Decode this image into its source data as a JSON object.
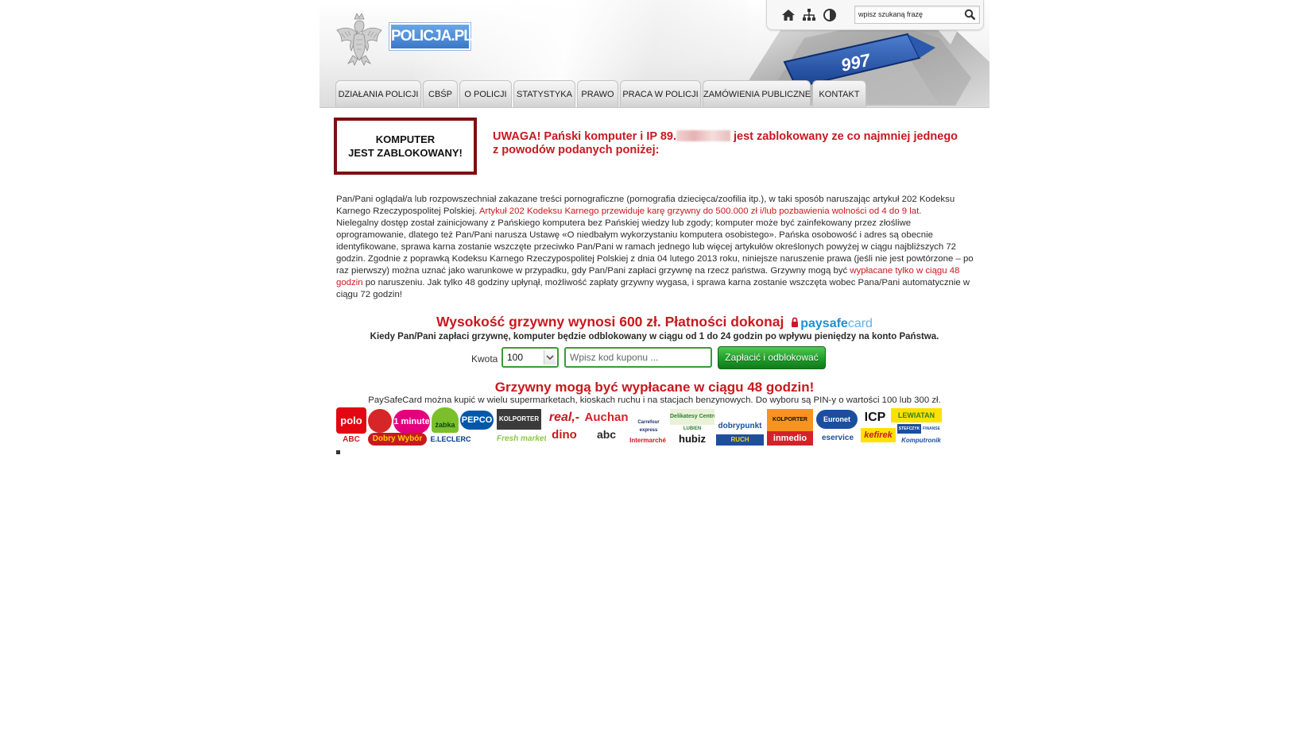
{
  "header": {
    "logo_text": "POLICJA.PL",
    "badge_number": "997",
    "search_placeholder": "wpisz szukaną frazę",
    "icons": [
      "home-icon",
      "sitemap-icon",
      "contrast-icon",
      "search-icon"
    ]
  },
  "nav": {
    "items": [
      {
        "label": "DZIAŁANIA POLICJI"
      },
      {
        "label": "CBŚP"
      },
      {
        "label": "O POLICJI"
      },
      {
        "label": "STATYSTYKA"
      },
      {
        "label": "PRAWO"
      },
      {
        "label": "PRACA W POLICJI"
      },
      {
        "label": "ZAMÓWIENIA PUBLICZNE"
      },
      {
        "label": "KONTAKT"
      }
    ]
  },
  "alert": {
    "box_line1": "KOMPUTER",
    "box_line2": "JEST ZABLOKOWANY!",
    "warning_part1": "UWAGA! Pański komputer i IP 89.",
    "warning_part2": " jest zablokowany ze co najmniej jednego",
    "warning_line2": "z powodów podanych poniżej:"
  },
  "body": {
    "p1_text": "Pan/Pani oglądał/a lub rozpowszechniał zakazane treści pornograficzne (pornografia dziecięca/zoofilia itp.), w taki sposób naruszając artykuł 202 Kodeksu Karnego Rzeczypospolitej Polskiej. ",
    "p1_red": "Artykuł 202 Kodeksu Karnego przewiduje karę grzywny do 500.000 zł i/lub pozbawienia wolności od 4 do 9 lat",
    "p1_end": ".",
    "p2_text": "Nielegalny dostęp został zainicjowany z Pańskiego komputera bez Pańskiej wiedzy lub zgody; komputer może być zainfekowany przez złośliwe oprogramowanie, dlatego też Pan/Pani narusza Ustawę «O niedbałym wykorzystaniu komputera osobistego». Pańska osobowość i adres są obecnie identyfikowane, sprawa karna zostanie wszczęte przeciwko Pan/Pani w ramach jednego lub więcej artykułów określonych powyżej w ciągu najbliższych 72 godzin. Zgodnie z poprawką Kodeksu Karnego Rzeczypospolitej Polskiej z dnia 04 lutego 2013 roku, niniejsze naruszenie prawa (jeśli nie jest powtórzone – po raz pierwszy) można uznać jako warunkowe w przypadku, gdy Pan/Pani zapłaci grzywnę na rzecz państwa. Grzywny mogą być ",
    "p2_red": "wypłacane tylko w ciągu 48 godzin",
    "p2_end": " po naruszeniu. Jak tylko 48 godziny upłynął, możliwość zapłaty grzywny wygasa, i sprawa karna zostanie wszczęta wobec Pana/Pani automatycznie w ciągu 72 godzin!"
  },
  "payment": {
    "fine_text": "Wysokość grzywny wynosi 600 zł. Płatności dokonaj",
    "paysafe_a": "paysafe",
    "paysafe_b": "card",
    "unlock_text": "Kiedy Pan/Pani zapłaci grzywnę, komputer będzie odblokowany w ciągu od 1 do 24 godzin po wpływu pieniędzy na konto Państwa.",
    "amount_label": "Kwota",
    "amount_value": "100",
    "coupon_placeholder": "Wpisz kod kuponu ...",
    "button_label": "Zapłacić i odblokować",
    "deadline_text": "Grzywny mogą być wypłacane w ciągu 48 godzin!",
    "buy_text": "PaySafeCard można kupić w wielu supermarketach, kioskach ruchu i na stacjach benzynowych. Do wyboru są PIN-y o wartości 100 lub 300 zł."
  },
  "retailers": {
    "polo": "polo",
    "abc_top": "ABC",
    "minute": "1 minute",
    "zabka": "żabka",
    "pepco": "PEPCO",
    "dobry_wybor": "Dobry Wybór",
    "leclerc": "E.LECLERC",
    "kolporter": "KOLPORTER",
    "fresh": "Fresh market",
    "real": "real,-",
    "dino": "dino",
    "auchan": "Auchan",
    "abc": "abc",
    "carrefour": "Carrefour express",
    "intermarche": "Intermarché",
    "delikatesy": "Delikatesy Centrum",
    "lubien": "LUBIEN",
    "hubiz": "hubiz",
    "dobrypunkt": "dobrypunkt",
    "ruch": "RUCH",
    "kolporter2": "KOLPORTER",
    "inmedio": "inmedio",
    "euronet": "Euronet",
    "eservice": "eservice",
    "icp": "ICP",
    "lewiatan": "LEWIATAN",
    "stefczyk": "STEFCZYK",
    "finanse": "FINANSE",
    "kefirek": "kefirek",
    "komputronik": "Komputronik"
  }
}
